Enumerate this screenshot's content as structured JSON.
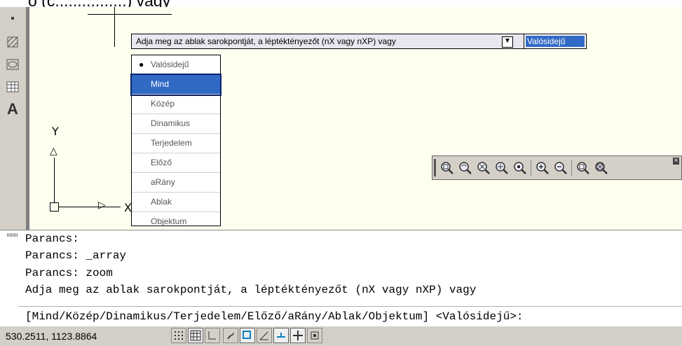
{
  "window_top_text": "ó (c................) vagy",
  "tooltip": {
    "prompt": "Adja meg az ablak sarokpontját, a léptéktényezőt (nX vagy nXP) vagy",
    "value": "Valósidejű"
  },
  "dropdown": {
    "items": [
      "Valósidejű",
      "Mind",
      "Közép",
      "Dinamikus",
      "Terjedelem",
      "Előző",
      "aRány",
      "Ablak",
      "Objektum"
    ],
    "selected_index": 1,
    "bullet_index": 0
  },
  "ucs": {
    "y_label": "Y",
    "x_label": "X"
  },
  "command_history": [
    "Parancs:",
    "Parancs: _array",
    "Parancs: zoom",
    "Adja meg az ablak sarokpontját, a léptéktényezőt (nX vagy nXP) vagy"
  ],
  "command_prompt": "[Mind/Közép/Dinamikus/Terjedelem/Előző/aRány/Ablak/Objektum] <Valósidejű>:",
  "status": {
    "coordinates": "530.2511, 1123.8864"
  },
  "colors": {
    "drawing_bg": "#fffff0",
    "selection": "#316ac5",
    "toolbar": "#d4d0c8"
  },
  "icons": {
    "left_toolbar": [
      "point-icon",
      "hatch-icon",
      "region-icon",
      "table-icon",
      "text-icon"
    ],
    "zoom_toolbar": [
      "zoom-window-icon",
      "zoom-dynamic-icon",
      "zoom-scale-icon",
      "zoom-center-icon",
      "zoom-object-icon",
      "zoom-in-icon",
      "zoom-out-icon",
      "zoom-all-icon",
      "zoom-extents-icon"
    ],
    "status_toggles": [
      "snap-icon",
      "grid-icon",
      "ortho-icon",
      "polar-icon",
      "osnap-icon",
      "otrack-icon",
      "ducs-icon",
      "dyn-icon",
      "lwt-icon"
    ]
  }
}
